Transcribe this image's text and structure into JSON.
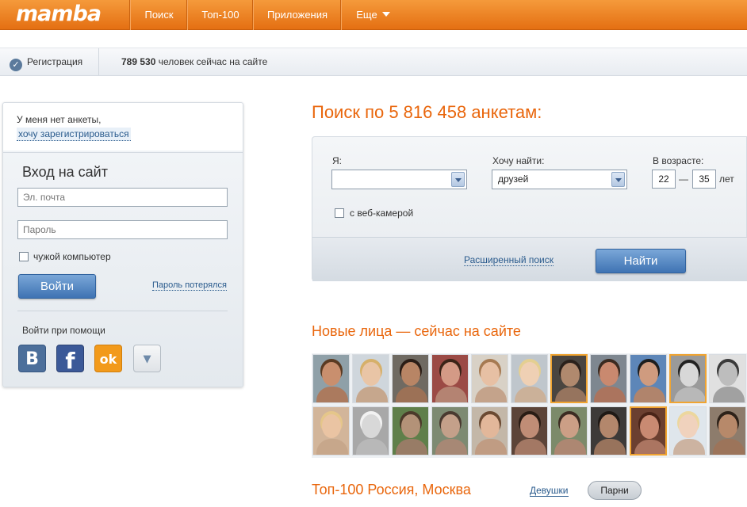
{
  "header": {
    "logo": "mamba",
    "nav": [
      {
        "label": "Поиск"
      },
      {
        "label": "Топ-100"
      },
      {
        "label": "Приложения"
      },
      {
        "label": "Еще"
      }
    ]
  },
  "subbar": {
    "register": "Регистрация",
    "online_count": "789 530",
    "online_text": "человек сейчас на сайте"
  },
  "login": {
    "no_profile": "У меня нет анкеты,",
    "register_link": "хочу зарегистрироваться",
    "title": "Вход на сайт",
    "email_placeholder": "Эл. почта",
    "password_placeholder": "Пароль",
    "foreign_computer": "чужой компьютер",
    "login_button": "Войти",
    "forgot_password": "Пароль потерялся",
    "social_label": "Войти при помощи",
    "social": [
      {
        "name": "vk",
        "glyph": "B",
        "color": "#4c6f9b"
      },
      {
        "name": "facebook",
        "glyph": "f",
        "color": "#3b5998"
      },
      {
        "name": "odnoklassniki",
        "glyph": "ok",
        "color": "#f29a1b"
      },
      {
        "name": "more",
        "glyph": "▼",
        "color": "#e6e9ec"
      }
    ]
  },
  "search": {
    "title": "Поиск по 5 816 458 анкетам:",
    "i_label": "Я:",
    "i_value": "",
    "want_label": "Хочу найти:",
    "want_value": "друзей",
    "age_label": "В возрасте:",
    "age_from": "22",
    "age_dash": "—",
    "age_to": "35",
    "age_unit": "лет",
    "webcam": "с веб-камерой",
    "advanced": "Расширенный поиск",
    "find_button": "Найти"
  },
  "faces": {
    "title": "Новые лица — сейчас на сайте",
    "tiles": [
      {
        "skin": "#c98f6e",
        "hair": "#5a3a22",
        "bg": "#8fa0a8",
        "highlight": false
      },
      {
        "skin": "#e9c5a6",
        "hair": "#d6b06a",
        "bg": "#cfd6dc",
        "highlight": false
      },
      {
        "skin": "#b88565",
        "hair": "#2a1d16",
        "bg": "#6f6a62",
        "highlight": false
      },
      {
        "skin": "#d49a86",
        "hair": "#3b2418",
        "bg": "#9b4a45",
        "highlight": false
      },
      {
        "skin": "#e7c0a4",
        "hair": "#a67a52",
        "bg": "#d8d1c6",
        "highlight": false
      },
      {
        "skin": "#efd0b4",
        "hair": "#e4cf91",
        "bg": "#bfc6cc",
        "highlight": false
      },
      {
        "skin": "#b0896e",
        "hair": "#2b211b",
        "bg": "#4a4540",
        "highlight": true
      },
      {
        "skin": "#c9896f",
        "hair": "#3a2a20",
        "bg": "#7e8790",
        "highlight": false
      },
      {
        "skin": "#cf9b7f",
        "hair": "#1e1e1e",
        "bg": "#5d86b8",
        "highlight": false
      },
      {
        "skin": "#d8d8d8",
        "hair": "#222222",
        "bg": "#9a9a9a",
        "highlight": true
      },
      {
        "skin": "#bdbdbd",
        "hair": "#3a3a3a",
        "bg": "#e0e0e0",
        "highlight": false
      },
      {
        "skin": "#eac4a3",
        "hair": "#e5c68a",
        "bg": "#d2b59a",
        "highlight": false
      },
      {
        "skin": "#d8d8d8",
        "hair": "#f2f2f2",
        "bg": "#a8a8a8",
        "highlight": false
      },
      {
        "skin": "#b39278",
        "hair": "#4b3a2a",
        "bg": "#5f7f4a",
        "highlight": false
      },
      {
        "skin": "#c4a08a",
        "hair": "#4a3a30",
        "bg": "#7d8a72",
        "highlight": false
      },
      {
        "skin": "#e2b79a",
        "hair": "#6b4a32",
        "bg": "#c3b7a8",
        "highlight": false
      },
      {
        "skin": "#c08d76",
        "hair": "#2a1c14",
        "bg": "#5c4438",
        "highlight": false
      },
      {
        "skin": "#cc9f86",
        "hair": "#3d2c22",
        "bg": "#7c8a6a",
        "highlight": false
      },
      {
        "skin": "#b3876c",
        "hair": "#1f1915",
        "bg": "#3d3a38",
        "highlight": false
      },
      {
        "skin": "#c98a72",
        "hair": "#4a2418",
        "bg": "#6b3f30",
        "highlight": true
      },
      {
        "skin": "#f0d2bd",
        "hair": "#ecd79e",
        "bg": "#dfe6ec",
        "highlight": false
      },
      {
        "skin": "#b7896a",
        "hair": "#2d2219",
        "bg": "#8d7c6c",
        "highlight": false
      }
    ]
  },
  "top100": {
    "title": "Топ-100 Россия, Москва",
    "girls": "Девушки",
    "boys": "Парни"
  }
}
